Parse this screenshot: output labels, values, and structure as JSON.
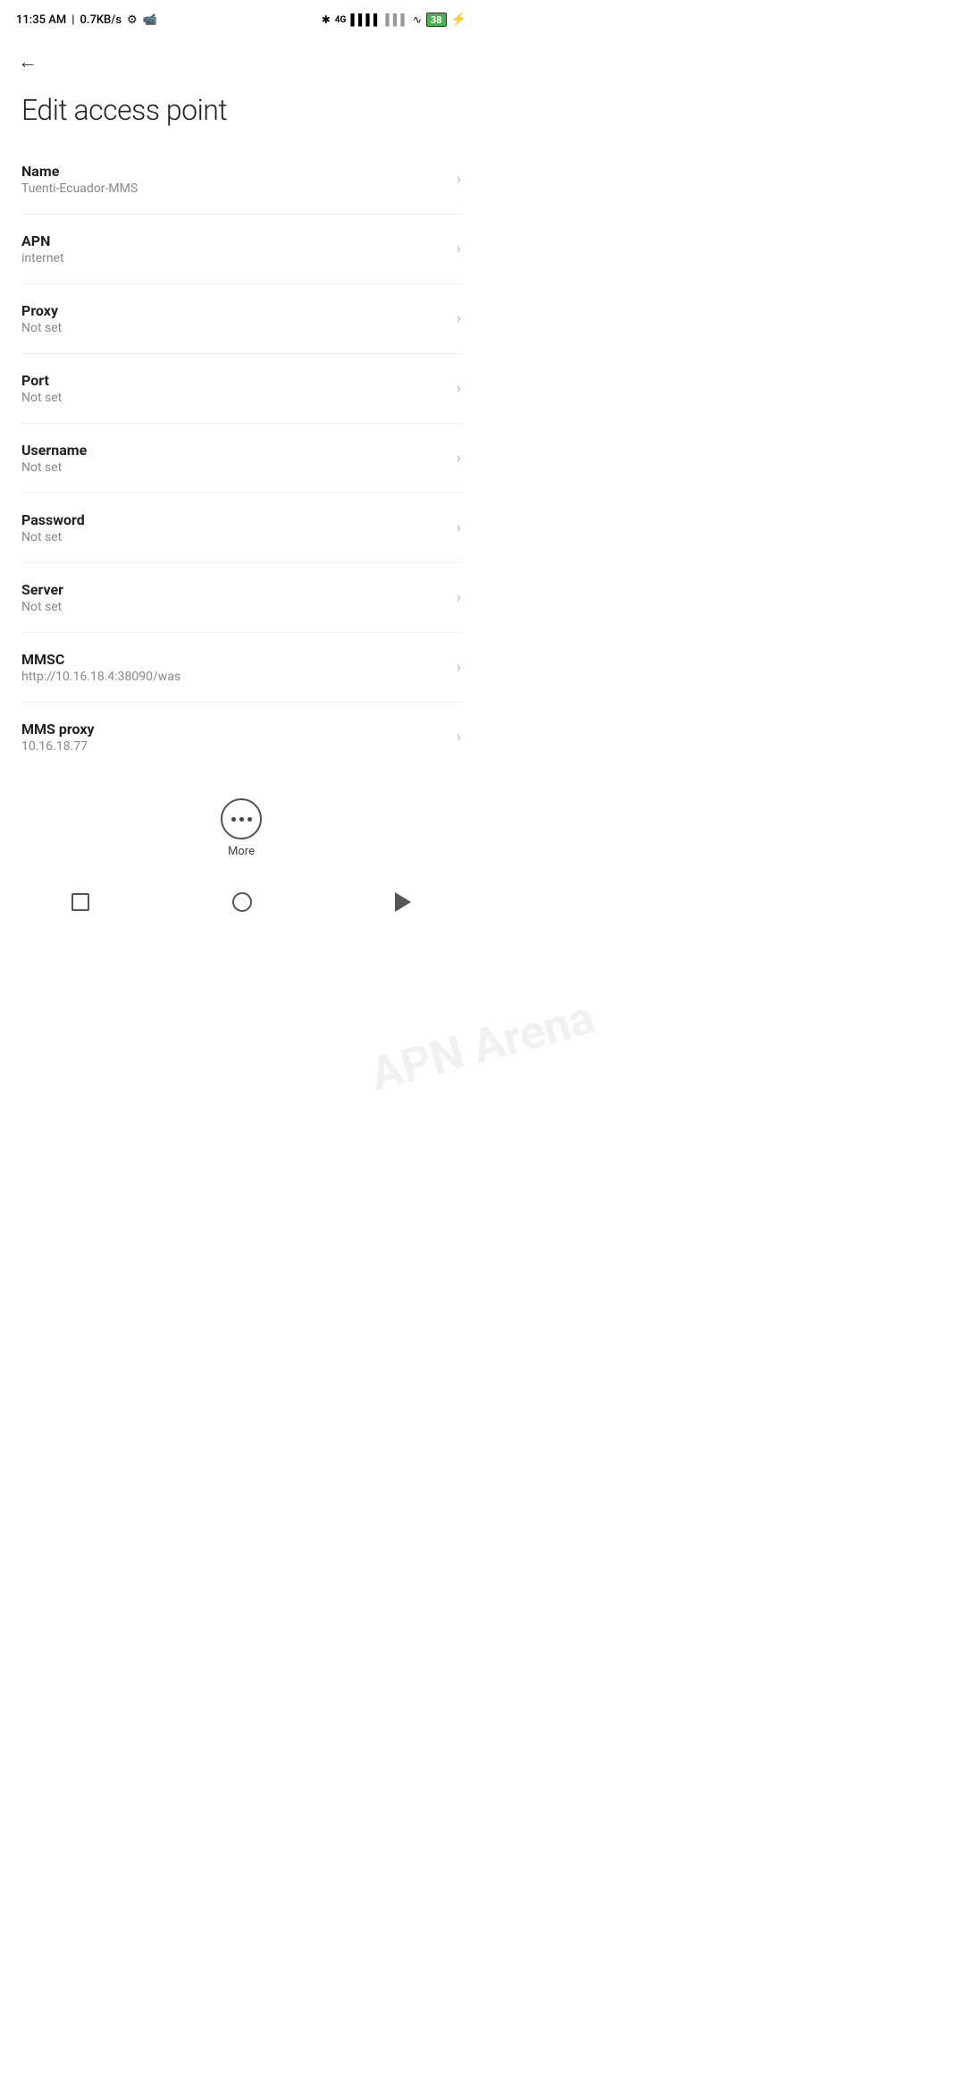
{
  "status_bar": {
    "time": "11:35 AM",
    "speed": "0.7KB/s",
    "battery_percent": "38"
  },
  "header": {
    "back_label": "←",
    "title": "Edit access point"
  },
  "watermark": {
    "line1": "APN Arena"
  },
  "settings": {
    "items": [
      {
        "label": "Name",
        "value": "Tuenti-Ecuador-MMS"
      },
      {
        "label": "APN",
        "value": "internet"
      },
      {
        "label": "Proxy",
        "value": "Not set"
      },
      {
        "label": "Port",
        "value": "Not set"
      },
      {
        "label": "Username",
        "value": "Not set"
      },
      {
        "label": "Password",
        "value": "Not set"
      },
      {
        "label": "Server",
        "value": "Not set"
      },
      {
        "label": "MMSC",
        "value": "http://10.16.18.4:38090/was"
      },
      {
        "label": "MMS proxy",
        "value": "10.16.18.77"
      }
    ]
  },
  "more": {
    "label": "More"
  },
  "bottom_nav": {
    "square_label": "recent-apps",
    "circle_label": "home",
    "triangle_label": "back"
  }
}
